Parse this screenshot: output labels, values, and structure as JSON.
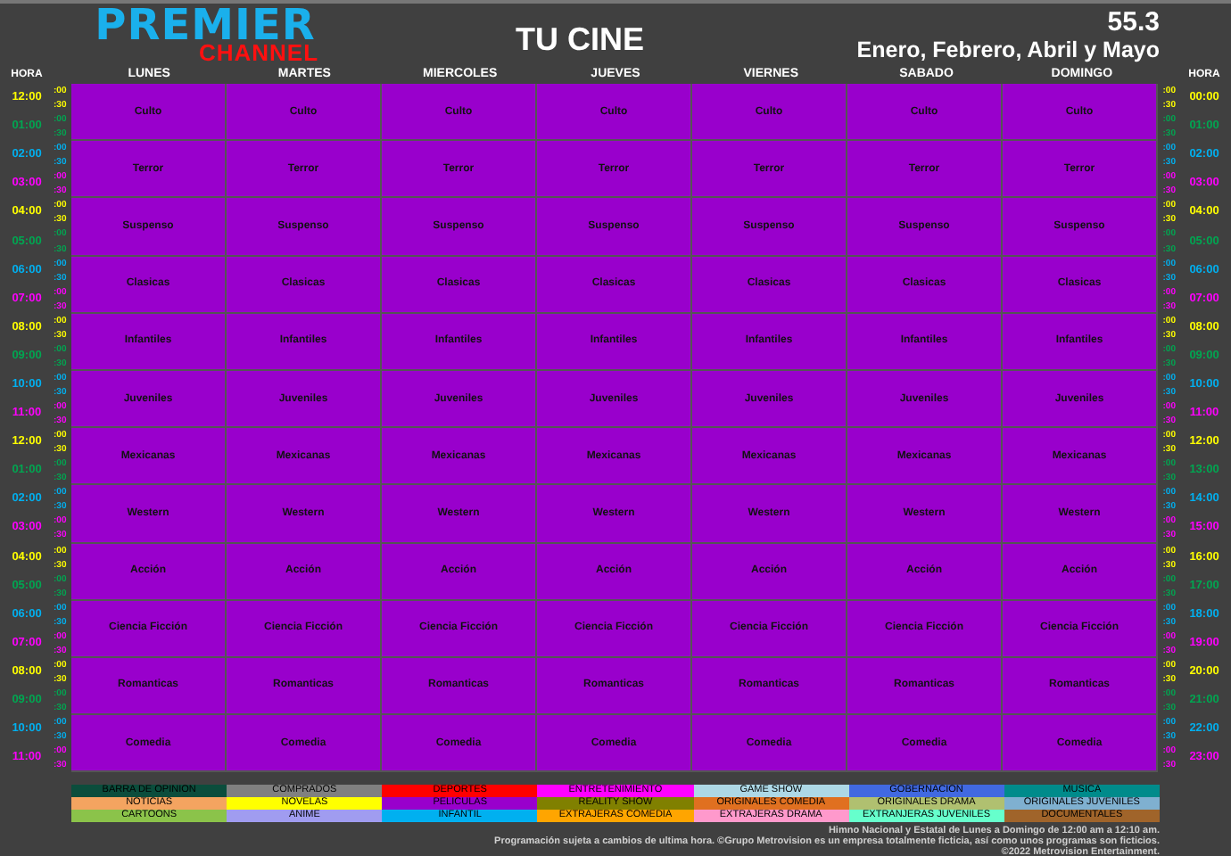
{
  "header": {
    "logo_top": "PREMIER",
    "logo_bottom": "CHANNEL",
    "title": "TU CINE",
    "channel_number": "55.3",
    "months": "Enero, Febrero, Abril y Mayo"
  },
  "grid": {
    "hour_label_left": "HORA",
    "hour_label_right": "HORA",
    "days": [
      "LUNES",
      "MARTES",
      "MIERCOLES",
      "JUEVES",
      "VIERNES",
      "SABADO",
      "DOMINGO"
    ],
    "blocks": [
      {
        "left_hours": [
          {
            "time": "12:00",
            "color": "#ffff00",
            "minutes": [
              ":00",
              ":30"
            ]
          },
          {
            "time": "01:00",
            "color": "#00a651",
            "minutes": [
              ":00",
              ":30"
            ]
          }
        ],
        "right_hours": [
          {
            "time": "00:00",
            "color": "#ffff00",
            "minutes": [
              ":00",
              ":30"
            ]
          },
          {
            "time": "01:00",
            "color": "#00a651",
            "minutes": [
              ":00",
              ":30"
            ]
          }
        ],
        "programs": [
          "Culto",
          "Culto",
          "Culto",
          "Culto",
          "Culto",
          "Culto",
          "Culto"
        ]
      },
      {
        "left_hours": [
          {
            "time": "02:00",
            "color": "#00b0f0",
            "minutes": [
              ":00",
              ":30"
            ]
          },
          {
            "time": "03:00",
            "color": "#ff00ff",
            "minutes": [
              ":00",
              ":30"
            ]
          }
        ],
        "right_hours": [
          {
            "time": "02:00",
            "color": "#00b0f0",
            "minutes": [
              ":00",
              ":30"
            ]
          },
          {
            "time": "03:00",
            "color": "#ff00ff",
            "minutes": [
              ":00",
              ":30"
            ]
          }
        ],
        "programs": [
          "Terror",
          "Terror",
          "Terror",
          "Terror",
          "Terror",
          "Terror",
          "Terror"
        ]
      },
      {
        "left_hours": [
          {
            "time": "04:00",
            "color": "#ffff00",
            "minutes": [
              ":00",
              ":30"
            ]
          },
          {
            "time": "05:00",
            "color": "#00a651",
            "minutes": [
              ":00",
              ":30"
            ]
          }
        ],
        "right_hours": [
          {
            "time": "04:00",
            "color": "#ffff00",
            "minutes": [
              ":00",
              ":30"
            ]
          },
          {
            "time": "05:00",
            "color": "#00a651",
            "minutes": [
              ":00",
              ":30"
            ]
          }
        ],
        "programs": [
          "Suspenso",
          "Suspenso",
          "Suspenso",
          "Suspenso",
          "Suspenso",
          "Suspenso",
          "Suspenso"
        ]
      },
      {
        "left_hours": [
          {
            "time": "06:00",
            "color": "#00b0f0",
            "minutes": [
              ":00",
              ":30"
            ]
          },
          {
            "time": "07:00",
            "color": "#ff00ff",
            "minutes": [
              ":00",
              ":30"
            ]
          }
        ],
        "right_hours": [
          {
            "time": "06:00",
            "color": "#00b0f0",
            "minutes": [
              ":00",
              ":30"
            ]
          },
          {
            "time": "07:00",
            "color": "#ff00ff",
            "minutes": [
              ":00",
              ":30"
            ]
          }
        ],
        "programs": [
          "Clasicas",
          "Clasicas",
          "Clasicas",
          "Clasicas",
          "Clasicas",
          "Clasicas",
          "Clasicas"
        ]
      },
      {
        "left_hours": [
          {
            "time": "08:00",
            "color": "#ffff00",
            "minutes": [
              ":00",
              ":30"
            ]
          },
          {
            "time": "09:00",
            "color": "#00a651",
            "minutes": [
              ":00",
              ":30"
            ]
          }
        ],
        "right_hours": [
          {
            "time": "08:00",
            "color": "#ffff00",
            "minutes": [
              ":00",
              ":30"
            ]
          },
          {
            "time": "09:00",
            "color": "#00a651",
            "minutes": [
              ":00",
              ":30"
            ]
          }
        ],
        "programs": [
          "Infantiles",
          "Infantiles",
          "Infantiles",
          "Infantiles",
          "Infantiles",
          "Infantiles",
          "Infantiles"
        ]
      },
      {
        "left_hours": [
          {
            "time": "10:00",
            "color": "#00b0f0",
            "minutes": [
              ":00",
              ":30"
            ]
          },
          {
            "time": "11:00",
            "color": "#ff00ff",
            "minutes": [
              ":00",
              ":30"
            ]
          }
        ],
        "right_hours": [
          {
            "time": "10:00",
            "color": "#00b0f0",
            "minutes": [
              ":00",
              ":30"
            ]
          },
          {
            "time": "11:00",
            "color": "#ff00ff",
            "minutes": [
              ":00",
              ":30"
            ]
          }
        ],
        "programs": [
          "Juveniles",
          "Juveniles",
          "Juveniles",
          "Juveniles",
          "Juveniles",
          "Juveniles",
          "Juveniles"
        ]
      },
      {
        "left_hours": [
          {
            "time": "12:00",
            "color": "#ffff00",
            "minutes": [
              ":00",
              ":30"
            ]
          },
          {
            "time": "01:00",
            "color": "#00a651",
            "minutes": [
              ":00",
              ":30"
            ]
          }
        ],
        "right_hours": [
          {
            "time": "12:00",
            "color": "#ffff00",
            "minutes": [
              ":00",
              ":30"
            ]
          },
          {
            "time": "13:00",
            "color": "#00a651",
            "minutes": [
              ":00",
              ":30"
            ]
          }
        ],
        "programs": [
          "Mexicanas",
          "Mexicanas",
          "Mexicanas",
          "Mexicanas",
          "Mexicanas",
          "Mexicanas",
          "Mexicanas"
        ]
      },
      {
        "left_hours": [
          {
            "time": "02:00",
            "color": "#00b0f0",
            "minutes": [
              ":00",
              ":30"
            ]
          },
          {
            "time": "03:00",
            "color": "#ff00ff",
            "minutes": [
              ":00",
              ":30"
            ]
          }
        ],
        "right_hours": [
          {
            "time": "14:00",
            "color": "#00b0f0",
            "minutes": [
              ":00",
              ":30"
            ]
          },
          {
            "time": "15:00",
            "color": "#ff00ff",
            "minutes": [
              ":00",
              ":30"
            ]
          }
        ],
        "programs": [
          "Western",
          "Western",
          "Western",
          "Western",
          "Western",
          "Western",
          "Western"
        ]
      },
      {
        "left_hours": [
          {
            "time": "04:00",
            "color": "#ffff00",
            "minutes": [
              ":00",
              ":30"
            ]
          },
          {
            "time": "05:00",
            "color": "#00a651",
            "minutes": [
              ":00",
              ":30"
            ]
          }
        ],
        "right_hours": [
          {
            "time": "16:00",
            "color": "#ffff00",
            "minutes": [
              ":00",
              ":30"
            ]
          },
          {
            "time": "17:00",
            "color": "#00a651",
            "minutes": [
              ":00",
              ":30"
            ]
          }
        ],
        "programs": [
          "Acción",
          "Acción",
          "Acción",
          "Acción",
          "Acción",
          "Acción",
          "Acción"
        ]
      },
      {
        "left_hours": [
          {
            "time": "06:00",
            "color": "#00b0f0",
            "minutes": [
              ":00",
              ":30"
            ]
          },
          {
            "time": "07:00",
            "color": "#ff00ff",
            "minutes": [
              ":00",
              ":30"
            ]
          }
        ],
        "right_hours": [
          {
            "time": "18:00",
            "color": "#00b0f0",
            "minutes": [
              ":00",
              ":30"
            ]
          },
          {
            "time": "19:00",
            "color": "#ff00ff",
            "minutes": [
              ":00",
              ":30"
            ]
          }
        ],
        "programs": [
          "Ciencia Ficción",
          "Ciencia Ficción",
          "Ciencia Ficción",
          "Ciencia Ficción",
          "Ciencia Ficción",
          "Ciencia Ficción",
          "Ciencia Ficción"
        ]
      },
      {
        "left_hours": [
          {
            "time": "08:00",
            "color": "#ffff00",
            "minutes": [
              ":00",
              ":30"
            ]
          },
          {
            "time": "09:00",
            "color": "#00a651",
            "minutes": [
              ":00",
              ":30"
            ]
          }
        ],
        "right_hours": [
          {
            "time": "20:00",
            "color": "#ffff00",
            "minutes": [
              ":00",
              ":30"
            ]
          },
          {
            "time": "21:00",
            "color": "#00a651",
            "minutes": [
              ":00",
              ":30"
            ]
          }
        ],
        "programs": [
          "Romanticas",
          "Romanticas",
          "Romanticas",
          "Romanticas",
          "Romanticas",
          "Romanticas",
          "Romanticas"
        ]
      },
      {
        "left_hours": [
          {
            "time": "10:00",
            "color": "#00b0f0",
            "minutes": [
              ":00",
              ":30"
            ]
          },
          {
            "time": "11:00",
            "color": "#ff00ff",
            "minutes": [
              ":00",
              ":30"
            ]
          }
        ],
        "right_hours": [
          {
            "time": "22:00",
            "color": "#00b0f0",
            "minutes": [
              ":00",
              ":30"
            ]
          },
          {
            "time": "23:00",
            "color": "#ff00ff",
            "minutes": [
              ":00",
              ":30"
            ]
          }
        ],
        "programs": [
          "Comedia",
          "Comedia",
          "Comedia",
          "Comedia",
          "Comedia",
          "Comedia",
          "Comedia"
        ]
      }
    ]
  },
  "legend": [
    {
      "label": "BARRA DE OPINION",
      "color": "#0b4d3c"
    },
    {
      "label": "COMPRADOS",
      "color": "#808080"
    },
    {
      "label": "DEPORTES",
      "color": "#ff0000"
    },
    {
      "label": "ENTRETENIMIENTO",
      "color": "#ff00ff"
    },
    {
      "label": "GAME SHOW",
      "color": "#add8e6"
    },
    {
      "label": "GOBERNACION",
      "color": "#4169e1"
    },
    {
      "label": "MUSICA",
      "color": "#008b8b"
    },
    {
      "label": "NOTICIAS",
      "color": "#f4a460"
    },
    {
      "label": "NOVELAS",
      "color": "#ffff00"
    },
    {
      "label": "PELICULAS",
      "color": "#9900cc"
    },
    {
      "label": "REALITY SHOW",
      "color": "#808000"
    },
    {
      "label": "ORIGINALES COMEDIA",
      "color": "#e07020"
    },
    {
      "label": "ORIGINALES DRAMA",
      "color": "#b0c070"
    },
    {
      "label": "ORIGINALES JUVENILES",
      "color": "#7fb0d0"
    },
    {
      "label": "CARTOONS",
      "color": "#8bc34a"
    },
    {
      "label": "ANIME",
      "color": "#a09cf0"
    },
    {
      "label": "INFANTIL",
      "color": "#00b0f0"
    },
    {
      "label": "EXTRAJERAS COMEDIA",
      "color": "#ffa500"
    },
    {
      "label": "EXTRAJERAS DRAMA",
      "color": "#ff99cc"
    },
    {
      "label": "EXTRANJERAS JUVENILES",
      "color": "#66ffcc"
    },
    {
      "label": "DOCUMENTALES",
      "color": "#a0642a"
    }
  ],
  "footer": [
    "Himno Nacional y Estatal de Lunes a Domingo de 12:00 am a 12:10 am.",
    "Programación sujeta a cambios de ultima hora. ©Grupo Metrovision es un empresa totalmente ficticia, así como unos programas son ficticios.",
    "©2022 Metrovision Entertainment."
  ]
}
